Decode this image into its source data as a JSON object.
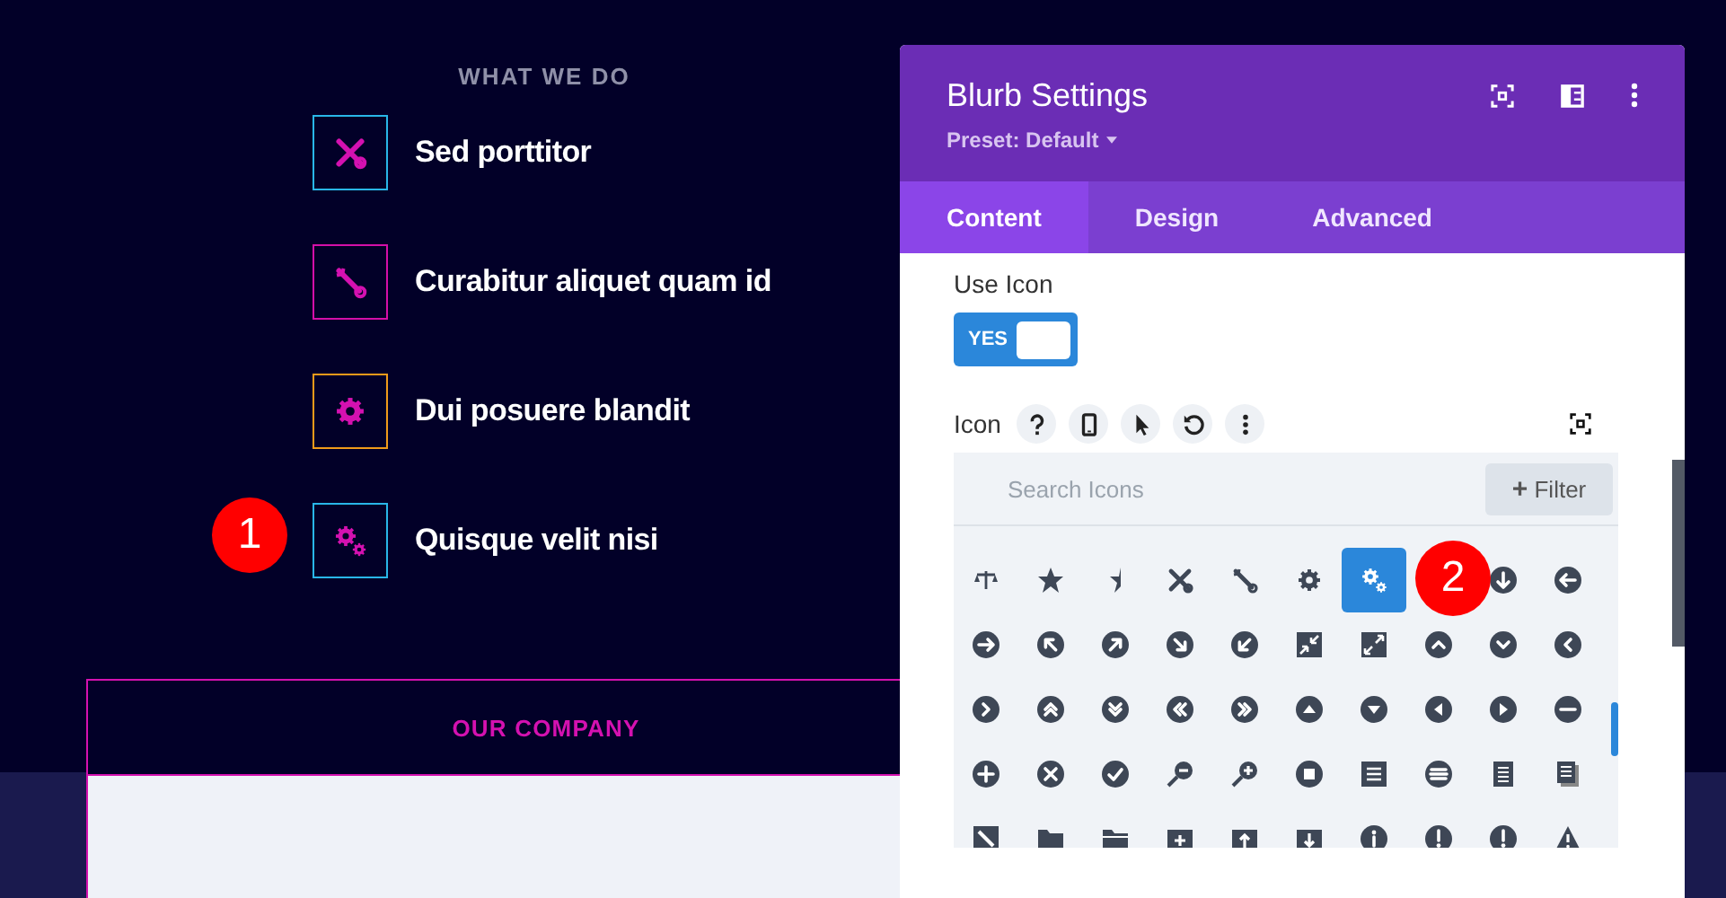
{
  "page": {
    "section_title": "WHAT WE DO",
    "blurbs": [
      {
        "title": "Sed porttitor",
        "color": "#29b6e8"
      },
      {
        "title": "Curabitur aliquet quam id",
        "color": "#d40fa8"
      },
      {
        "title": "Dui posuere blandit",
        "color": "#f09a1a"
      },
      {
        "title": "Quisque velit nisi",
        "color": "#29b6e8"
      }
    ],
    "company_box": {
      "title": "OUR COMPANY"
    }
  },
  "settings_panel": {
    "title": "Blurb Settings",
    "preset": "Preset: Default",
    "tabs": [
      {
        "label": "Content",
        "selected": true
      },
      {
        "label": "Design",
        "selected": false
      },
      {
        "label": "Advanced",
        "selected": false
      }
    ],
    "use_icon": {
      "label": "Use Icon",
      "on": true,
      "text": "YES"
    },
    "icon_field": {
      "label": "Icon",
      "search": {
        "placeholder": "Search Icons"
      },
      "filter_symbol": "+",
      "filter_button": "Filter",
      "options": [
        {
          "selected": false
        },
        {
          "selected": false
        },
        {
          "selected": false
        },
        {
          "selected": false
        },
        {
          "selected": false
        },
        {
          "selected": false
        },
        {
          "selected": true
        },
        {
          "selected": false
        },
        {
          "selected": false
        },
        {
          "selected": false
        },
        {
          "selected": false
        },
        {
          "selected": false
        },
        {
          "selected": false
        },
        {
          "selected": false
        },
        {
          "selected": false
        },
        {
          "selected": false
        },
        {
          "selected": false
        },
        {
          "selected": false
        },
        {
          "selected": false
        },
        {
          "selected": false
        },
        {
          "selected": false
        },
        {
          "selected": false
        },
        {
          "selected": false
        },
        {
          "selected": false
        },
        {
          "selected": false
        },
        {
          "selected": false
        },
        {
          "selected": false
        },
        {
          "selected": false
        },
        {
          "selected": false
        },
        {
          "selected": false
        },
        {
          "selected": false
        },
        {
          "selected": false
        },
        {
          "selected": false
        },
        {
          "selected": false
        },
        {
          "selected": false
        },
        {
          "selected": false
        },
        {
          "selected": false
        },
        {
          "selected": false
        },
        {
          "selected": false
        },
        {
          "selected": false
        },
        {
          "selected": false
        },
        {
          "selected": false
        },
        {
          "selected": false
        },
        {
          "selected": false
        },
        {
          "selected": false
        },
        {
          "selected": false
        },
        {
          "selected": false
        },
        {
          "selected": false
        },
        {
          "selected": false
        }
      ]
    }
  },
  "annotations": [
    {
      "label": "1"
    },
    {
      "label": "2"
    }
  ]
}
